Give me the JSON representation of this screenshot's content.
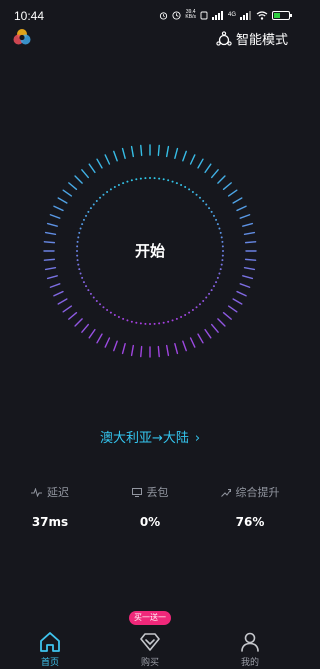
{
  "status_bar": {
    "time": "10:44",
    "speed": "39.4",
    "speed_unit": "KB/s",
    "network": "4G",
    "icons": [
      "alarm-icon",
      "clock-icon",
      "nfc-icon",
      "signal-5g-icon",
      "signal-4g-icon",
      "wifi-icon",
      "battery-icon"
    ],
    "battery_level": 0.45,
    "battery_color": "#2ecc40"
  },
  "header": {
    "logo": "app-logo-icon",
    "mode_icon": "smart-mode-icon",
    "mode_label": "智能模式"
  },
  "dial": {
    "start_label": "开始",
    "gradient_top": "#2fc6e6",
    "gradient_bottom": "#a63ee0"
  },
  "route": {
    "label": "澳大利亚→大陆",
    "chevron": "›"
  },
  "stats": [
    {
      "icon": "latency-icon",
      "label": "延迟",
      "value": "37ms"
    },
    {
      "icon": "packet-loss-icon",
      "label": "丢包",
      "value": "0%"
    },
    {
      "icon": "boost-icon",
      "label": "综合提升",
      "value": "76%"
    }
  ],
  "nav": {
    "promo_badge": "买一送一",
    "items": [
      {
        "icon": "home-icon",
        "label": "首页",
        "active": true
      },
      {
        "icon": "diamond-icon",
        "label": "购买",
        "active": false
      },
      {
        "icon": "user-icon",
        "label": "我的",
        "active": false
      }
    ],
    "accent": "#3fc4ee"
  }
}
